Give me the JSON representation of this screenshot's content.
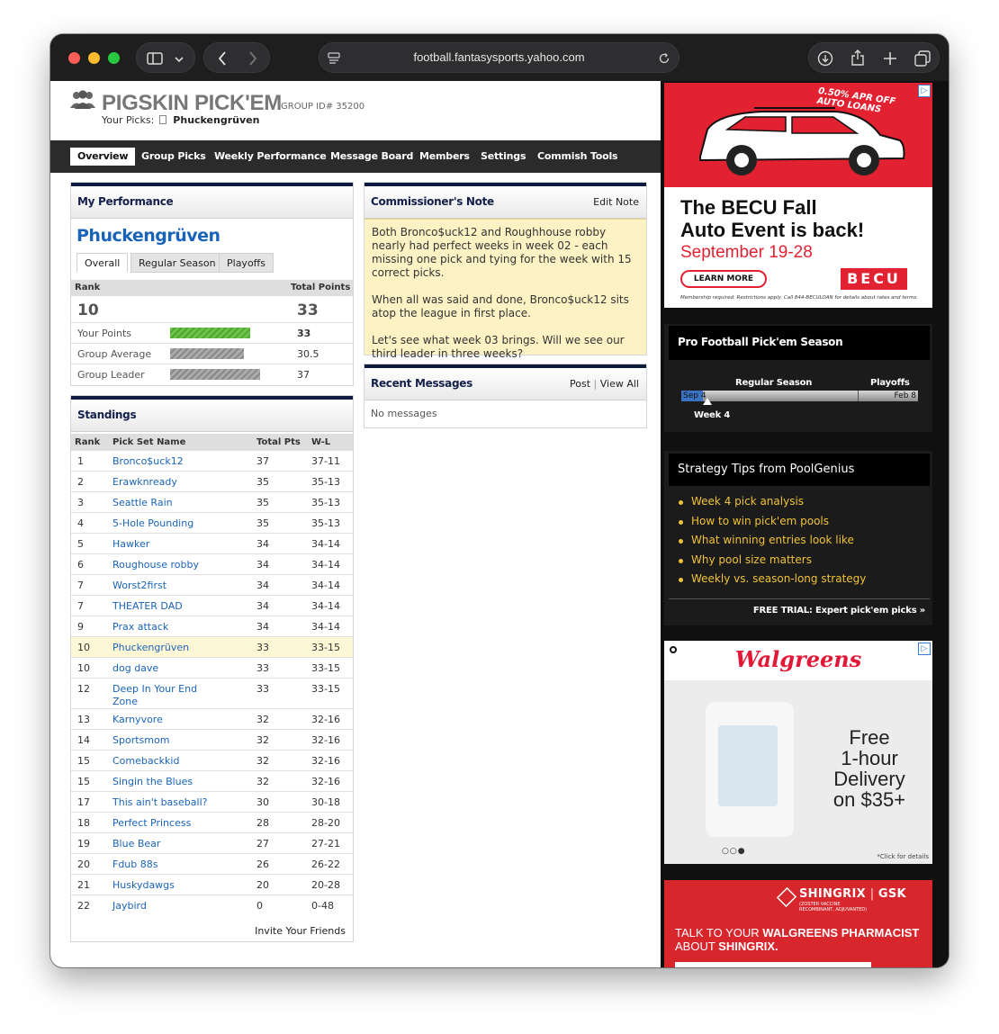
{
  "browser": {
    "url": "football.fantasysports.yahoo.com"
  },
  "header": {
    "title": "PIGSKIN PICK'EM",
    "group_id": "GROUP ID# 35200",
    "your_picks_label": "Your Picks:",
    "your_picks_name": "Phuckengrüven"
  },
  "nav": {
    "tabs": [
      {
        "label": "Overview",
        "active": true
      },
      {
        "label": "Group Picks"
      },
      {
        "label": "Weekly Performance"
      },
      {
        "label": "Message Board"
      },
      {
        "label": "Members"
      },
      {
        "label": "Settings"
      },
      {
        "label": "Commish Tools"
      }
    ]
  },
  "performance": {
    "title": "My Performance",
    "team_name": "Phuckengrüven",
    "tabs": [
      "Overall",
      "Regular Season",
      "Playoffs"
    ],
    "rank_label": "Rank",
    "total_points_label": "Total Points",
    "rank": "10",
    "total_points": "33",
    "rows": [
      {
        "label": "Your Points",
        "value": "33",
        "fraction": 0.892,
        "color": "#5cb83c"
      },
      {
        "label": "Group Average",
        "value": "30.5",
        "fraction": 0.824,
        "color": "#999999"
      },
      {
        "label": "Group Leader",
        "value": "37",
        "fraction": 1.0,
        "color": "#999999"
      }
    ]
  },
  "standings": {
    "title": "Standings",
    "headers": {
      "rank": "Rank",
      "name": "Pick Set Name",
      "pts": "Total Pts",
      "wl": "W-L"
    },
    "rows": [
      {
        "rank": "1",
        "name": "Bronco$uck12",
        "pts": "37",
        "wl": "37-11"
      },
      {
        "rank": "2",
        "name": "Erawknready",
        "pts": "35",
        "wl": "35-13"
      },
      {
        "rank": "3",
        "name": "Seattle Rain",
        "pts": "35",
        "wl": "35-13"
      },
      {
        "rank": "4",
        "name": "5-Hole Pounding",
        "pts": "35",
        "wl": "35-13"
      },
      {
        "rank": "5",
        "name": "Hawker",
        "pts": "34",
        "wl": "34-14"
      },
      {
        "rank": "6",
        "name": "Roughouse robby",
        "pts": "34",
        "wl": "34-14"
      },
      {
        "rank": "7",
        "name": "Worst2first",
        "pts": "34",
        "wl": "34-14"
      },
      {
        "rank": "7",
        "name": "THEATER DAD",
        "pts": "34",
        "wl": "34-14"
      },
      {
        "rank": "9",
        "name": "Prax attack",
        "pts": "34",
        "wl": "34-14"
      },
      {
        "rank": "10",
        "name": "Phuckengrüven",
        "pts": "33",
        "wl": "33-15",
        "highlight": true
      },
      {
        "rank": "10",
        "name": "dog dave",
        "pts": "33",
        "wl": "33-15"
      },
      {
        "rank": "12",
        "name": "Deep In Your End Zone",
        "pts": "33",
        "wl": "33-15",
        "tall": true
      },
      {
        "rank": "13",
        "name": "Karnyvore",
        "pts": "32",
        "wl": "32-16"
      },
      {
        "rank": "14",
        "name": "Sportsmom",
        "pts": "32",
        "wl": "32-16"
      },
      {
        "rank": "15",
        "name": "Comebackkid",
        "pts": "32",
        "wl": "32-16"
      },
      {
        "rank": "15",
        "name": "Singin the Blues",
        "pts": "32",
        "wl": "32-16"
      },
      {
        "rank": "17",
        "name": "This ain't baseball?",
        "pts": "30",
        "wl": "30-18"
      },
      {
        "rank": "18",
        "name": "Perfect Princess",
        "pts": "28",
        "wl": "28-20"
      },
      {
        "rank": "19",
        "name": "Blue Bear",
        "pts": "27",
        "wl": "27-21"
      },
      {
        "rank": "20",
        "name": "Fdub 88s",
        "pts": "26",
        "wl": "26-22"
      },
      {
        "rank": "21",
        "name": "Huskydawgs",
        "pts": "20",
        "wl": "20-28"
      },
      {
        "rank": "22",
        "name": "Jaybird",
        "pts": "0",
        "wl": "0-48"
      }
    ],
    "invite": "Invite Your Friends"
  },
  "commissioner": {
    "title": "Commissioner's Note",
    "edit": "Edit Note",
    "paragraphs": [
      "Both Bronco$uck12 and Roughhouse robby nearly had perfect weeks in week 02 - each missing one pick and tying for the week with 15 correct picks.",
      "When all was said and done, Bronco$uck12 sits atop the league in first place.",
      "Let's see what week 03 brings. Will we see our third leader in three weeks?"
    ]
  },
  "messages": {
    "title": "Recent Messages",
    "post": "Post",
    "view_all": "View All",
    "empty": "No messages"
  },
  "ads": {
    "becu": {
      "promo": "0.50% APR OFF AUTO LOANS",
      "headline1": "The BECU Fall",
      "headline2": "Auto Event is back!",
      "dates": "September 19-28",
      "cta": "LEARN MORE",
      "logo": "BECU",
      "fine": "Membership required. Restrictions apply. Call 844-BECULOAN for details about rates and terms."
    },
    "walgreens": {
      "logo": "Walgreens",
      "line1": "Free",
      "line2": "1-hour",
      "line3": "Delivery",
      "line4": "on $35+",
      "fine": "*Click for details"
    },
    "gsk": {
      "brand": "SHINGRIX",
      "brand2": "GSK",
      "sub": "(ZOSTER VACCINE RECOMBINANT, ADJUVANTED)",
      "line1_pre": "TALK TO YOUR ",
      "line1_bold": "WALGREENS PHARMACIST",
      "line2_pre": "ABOUT ",
      "line2_bold": "SHINGRIX."
    }
  },
  "season": {
    "title": "Pro Football Pick'em Season",
    "regular": "Regular Season",
    "playoffs": "Playoffs",
    "start": "Sep 4",
    "end": "Feb 8",
    "current": "Week 4",
    "progress": 0.09
  },
  "tips": {
    "title": "Strategy Tips from PoolGenius",
    "items": [
      "Week 4 pick analysis",
      "How to win pick'em pools",
      "What winning entries look like",
      "Why pool size matters",
      "Weekly vs. season-long strategy"
    ],
    "trial": "FREE TRIAL: Expert pick'em picks »"
  }
}
